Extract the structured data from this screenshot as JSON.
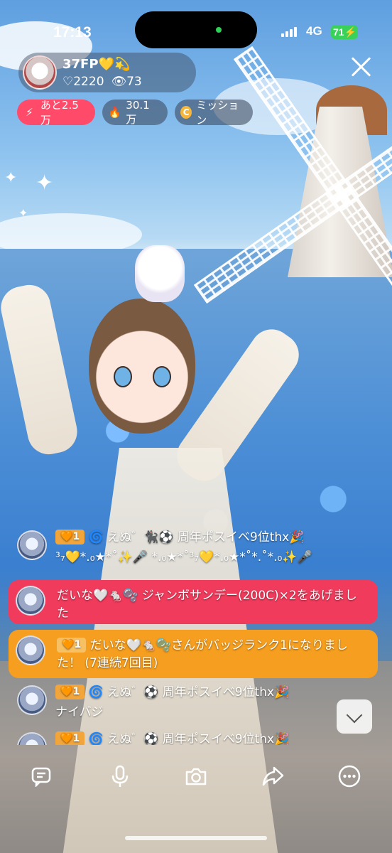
{
  "status_bar": {
    "time": "17:13",
    "network": "4G",
    "battery": "71"
  },
  "host": {
    "name": "37FP💛💫",
    "likes": "♡2220",
    "viewers": "👁73"
  },
  "chips": {
    "remaining": "あと2.5万",
    "points": "30.1万",
    "mission": "ミッション"
  },
  "chat": [
    {
      "badge": "1",
      "text": "🌀 えぬ゛🐈‍⬛⚽ 周年ポスイベ9位thx🎉",
      "second_line": "³₇💛*.₀★*˚✨🎤 *.₀★*˚³₇💛*.₀★*˚*.˚*.₀✨🎤"
    },
    {
      "type": "gift",
      "color": "#f03b5c",
      "text": "だいな🤍🐁🫧 ジャンボサンデー(200C)×2をあげました"
    },
    {
      "type": "badge-rank",
      "color": "#f59e1f",
      "badge": "1",
      "text": "だいな🤍🐁🫧さんがバッジランク1になりました！ (7連続7回目)"
    },
    {
      "badge": "1",
      "text": "🌀 えぬ゛⚽ 周年ポスイベ9位thx🎉",
      "second_line": "ナイバジ"
    },
    {
      "badge": "1",
      "text": "🌀 えぬ゛⚽ 周年ポスイベ9位thx🎉"
    }
  ],
  "toolbar": {
    "icons": [
      "chat-icon",
      "microphone-icon",
      "camera-icon",
      "share-icon",
      "more-icon"
    ]
  },
  "colors": {
    "gift_red": "#f03b5c",
    "badge_orange": "#f59e1f",
    "chip_red": "#ff4a6a",
    "battery_green": "#3ad15a"
  }
}
